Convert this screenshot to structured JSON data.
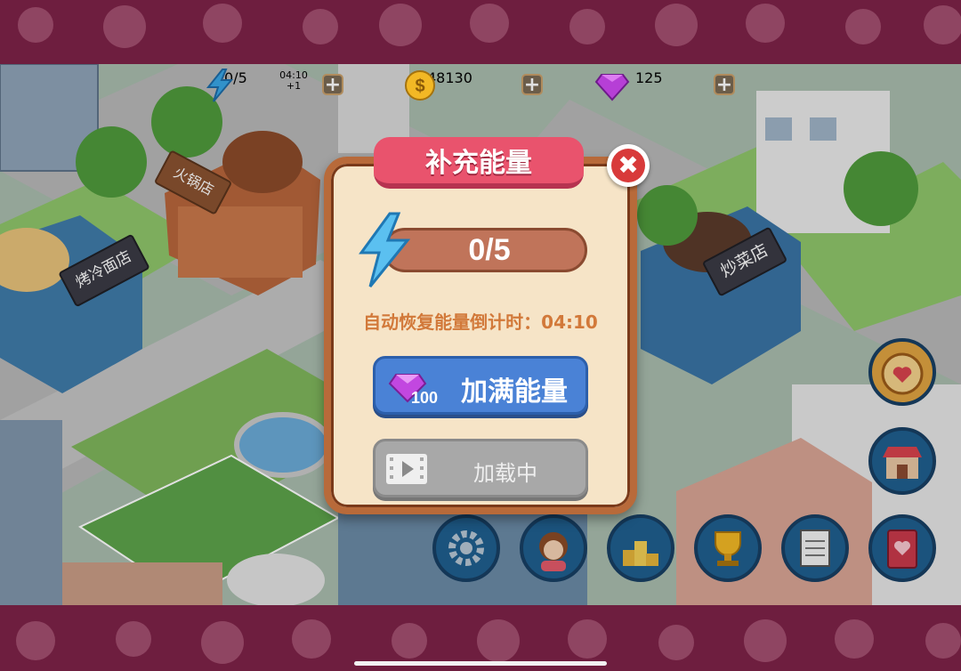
{
  "hud": {
    "energy": {
      "value": "0/5",
      "timer": "04:10",
      "increment": "+1",
      "plus": "+"
    },
    "coins": {
      "value": "48130",
      "plus": "+"
    },
    "gems": {
      "value": "125",
      "plus": "+"
    }
  },
  "scene_signs": {
    "hotpot": "火锅店",
    "bbq_noodles": "烤冷面店",
    "stir_fry": "炒菜店"
  },
  "dialog": {
    "title": "补充能量",
    "close": "✖",
    "energy_display": "0/5",
    "energy_fraction": 0,
    "countdown": "自动恢复能量倒计时：04:10",
    "fill_button": {
      "label": "加满能量",
      "cost": "100"
    },
    "video_button": {
      "label": "加载中"
    }
  },
  "colors": {
    "band": "#6e1e3f",
    "ribbon": "#e9536d",
    "fill_button": "#4a82d6",
    "loading_button": "#a8a8a8",
    "countdown_text": "#d2793a"
  },
  "icons": {
    "energy": "lightning-bolt-icon",
    "coin": "dollar-coin-icon",
    "gem": "purple-diamond-icon",
    "close": "close-icon",
    "video": "film-strip-icon",
    "settings": "gear-icon",
    "character": "chef-avatar-icon",
    "podium": "podium-icon",
    "trophy": "trophy-icon",
    "notepad": "notepad-icon",
    "recipe_book": "recipe-book-icon",
    "shop": "shop-icon",
    "roulette": "heart-wheel-icon"
  }
}
